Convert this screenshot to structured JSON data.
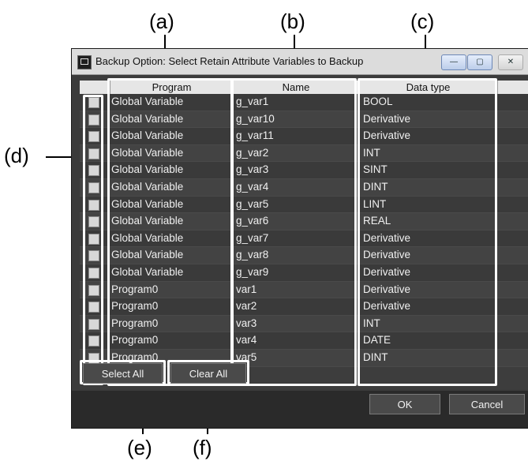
{
  "callouts": {
    "a": "(a)",
    "b": "(b)",
    "c": "(c)",
    "d": "(d)",
    "e": "(e)",
    "f": "(f)"
  },
  "window": {
    "title": "Backup Option: Select Retain Attribute Variables to Backup",
    "minimize_glyph": "—",
    "maximize_glyph": "▢",
    "close_glyph": "✕"
  },
  "table": {
    "headers": {
      "program": "Program",
      "name": "Name",
      "data_type": "Data type"
    },
    "rows": [
      {
        "program": "Global Variable",
        "name": "g_var1",
        "type": "BOOL",
        "checked": false
      },
      {
        "program": "Global Variable",
        "name": "g_var10",
        "type": "Derivative",
        "checked": false
      },
      {
        "program": "Global Variable",
        "name": "g_var11",
        "type": "Derivative",
        "checked": false
      },
      {
        "program": "Global Variable",
        "name": "g_var2",
        "type": "INT",
        "checked": false
      },
      {
        "program": "Global Variable",
        "name": "g_var3",
        "type": "SINT",
        "checked": false
      },
      {
        "program": "Global Variable",
        "name": "g_var4",
        "type": "DINT",
        "checked": false
      },
      {
        "program": "Global Variable",
        "name": "g_var5",
        "type": "LINT",
        "checked": false
      },
      {
        "program": "Global Variable",
        "name": "g_var6",
        "type": "REAL",
        "checked": false
      },
      {
        "program": "Global Variable",
        "name": "g_var7",
        "type": "Derivative",
        "checked": false
      },
      {
        "program": "Global Variable",
        "name": "g_var8",
        "type": "Derivative",
        "checked": false
      },
      {
        "program": "Global Variable",
        "name": "g_var9",
        "type": "Derivative",
        "checked": false
      },
      {
        "program": "Program0",
        "name": "var1",
        "type": "Derivative",
        "checked": false
      },
      {
        "program": "Program0",
        "name": "var2",
        "type": "Derivative",
        "checked": false
      },
      {
        "program": "Program0",
        "name": "var3",
        "type": "INT",
        "checked": false
      },
      {
        "program": "Program0",
        "name": "var4",
        "type": "DATE",
        "checked": false
      },
      {
        "program": "Program0",
        "name": "var5",
        "type": "DINT",
        "checked": false
      }
    ]
  },
  "buttons": {
    "select_all": "Select All",
    "clear_all": "Clear All",
    "ok": "OK",
    "cancel": "Cancel"
  },
  "colors": {
    "panel_bg": "#3d3d3d",
    "highlight_box": "#ffffff",
    "text": "#f0f0f0"
  }
}
